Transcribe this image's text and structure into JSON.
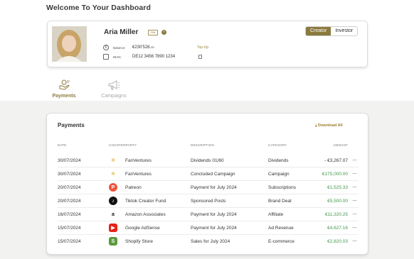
{
  "page": {
    "title": "Welcome To Your Dashboard"
  },
  "profile": {
    "name": "Aria Miller",
    "flag_text": "FAN",
    "balance_label": "Balance:",
    "balance_value": "€230'528.",
    "balance_cents": "25",
    "iban_label": "IBAN:",
    "iban_value": "DE12 3456 7890 1234",
    "topup_label": "Top-Up",
    "roles": [
      "Creator",
      "Investor"
    ],
    "active_role": "Creator"
  },
  "tabs": [
    {
      "label": "Payments",
      "icon": "payments-icon",
      "active": true
    },
    {
      "label": "Campaigns",
      "icon": "megaphone-icon",
      "active": false
    }
  ],
  "payments": {
    "title": "Payments",
    "download_label": "Download All",
    "columns": [
      "DATE",
      "COUNTERPARTY",
      "DESCRIPTION",
      "CATEGORY",
      "AMOUNT"
    ],
    "rows": [
      {
        "date": "30/07/2024",
        "counterparty": "FanVentures",
        "logo": "fanventures-logo",
        "logo_char": "✳",
        "logo_color": "#e8c45a",
        "logo_bg": "#ffffff",
        "description": "Dividends 01/60",
        "category": "Dividends",
        "amount": "- €3,267.07",
        "sign": "neg"
      },
      {
        "date": "30/07/2024",
        "counterparty": "FanVentures",
        "logo": "fanventures-logo",
        "logo_char": "✳",
        "logo_color": "#e8c45a",
        "logo_bg": "#ffffff",
        "description": "Concluded Campaign",
        "category": "Campaign",
        "amount": "€175,000.00",
        "sign": "pos"
      },
      {
        "date": "20/07/2024",
        "counterparty": "Patreon",
        "logo": "patreon-logo",
        "logo_char": "P",
        "logo_color": "#ffffff",
        "logo_bg": "#f0543e",
        "description": "Payment for July 2024",
        "category": "Subscriptions",
        "amount": "€1,525.33",
        "sign": "pos"
      },
      {
        "date": "20/07/2024",
        "counterparty": "Tiktok Creator Fund",
        "logo": "tiktok-logo",
        "logo_char": "♪",
        "logo_color": "#ffffff",
        "logo_bg": "#111111",
        "description": "Sponsored Posts",
        "category": "Brand Deal",
        "amount": "€5,500.00",
        "sign": "pos"
      },
      {
        "date": "16/07/2024",
        "counterparty": "Amazon Associates",
        "logo": "amazon-logo",
        "logo_char": "a",
        "logo_color": "#111111",
        "logo_bg": "#ffffff",
        "description": "Payment for July 2024",
        "category": "Affiliate",
        "amount": "€11,320.25",
        "sign": "pos"
      },
      {
        "date": "15/07/2024",
        "counterparty": "Google AdSense",
        "logo": "youtube-logo",
        "logo_char": "▶",
        "logo_color": "#ffffff",
        "logo_bg": "#e62117",
        "description": "Payment for July 2024",
        "category": "Ad Revenue",
        "amount": "€4,627.16",
        "sign": "pos"
      },
      {
        "date": "15/07/2024",
        "counterparty": "Shopify Store",
        "logo": "shopify-logo",
        "logo_char": "S",
        "logo_color": "#ffffff",
        "logo_bg": "#5a9a3c",
        "description": "Sales for July 2024",
        "category": "E-commerce",
        "amount": "€2,820.03",
        "sign": "pos"
      }
    ],
    "more_label": "···"
  },
  "colors": {
    "accent": "#8a7a3e",
    "positive": "#3e9a4a",
    "background_lower": "#f2f2f1"
  }
}
